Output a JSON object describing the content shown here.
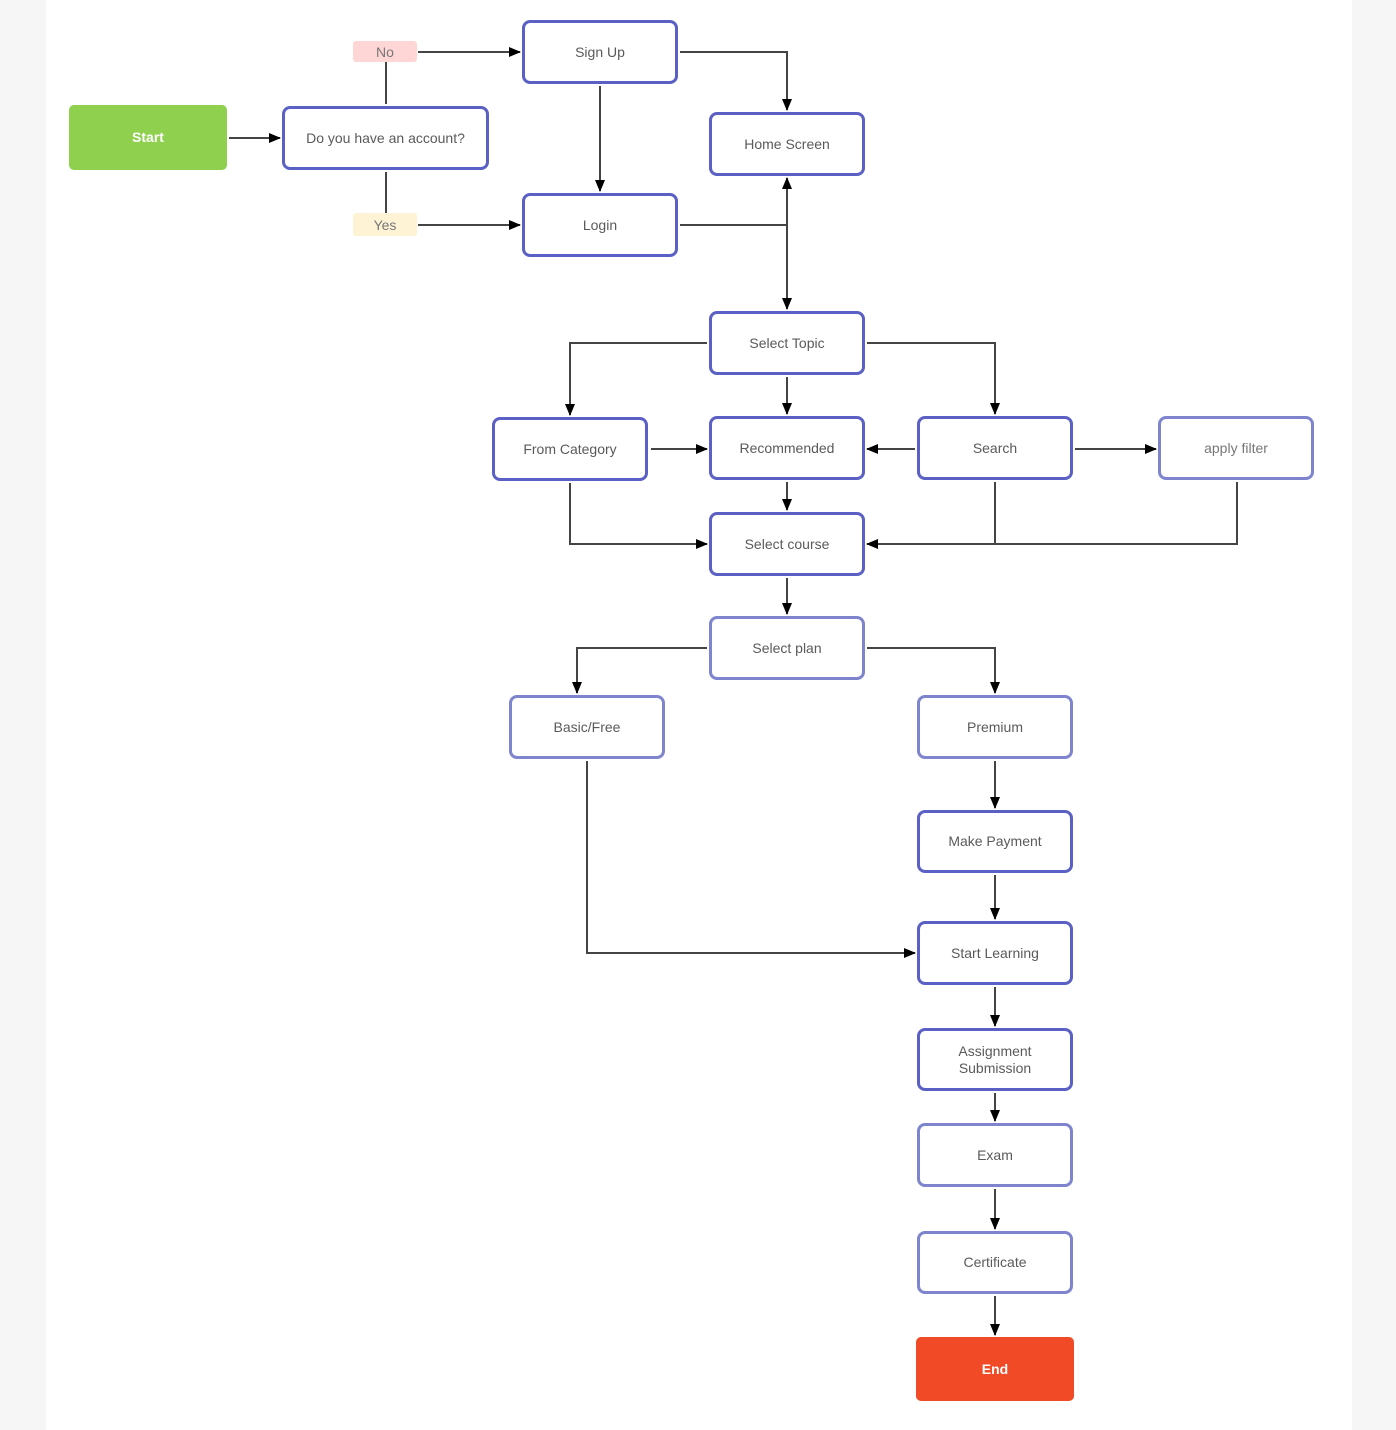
{
  "colors": {
    "node_border": "#5b60c4",
    "start": "#8fd14f",
    "end": "#f04a26",
    "no_tag": "#ffd6d6",
    "yes_tag": "#fff3d6",
    "connector": "#444444"
  },
  "nodes": {
    "start": "Start",
    "question": "Do you have an account?",
    "sign_up": "Sign Up",
    "login": "Login",
    "home": "Home Screen",
    "select_topic": "Select Topic",
    "from_category": "From Category",
    "recommended": "Recommended",
    "search": "Search",
    "apply_filter": "apply filter",
    "select_course": "Select course",
    "select_plan": "Select plan",
    "basic": "Basic/Free",
    "premium": "Premium",
    "payment": "Make Payment",
    "start_learning": "Start Learning",
    "assignment": "Assignment Submission",
    "exam": "Exam",
    "certificate": "Certificate",
    "end": "End"
  },
  "tags": {
    "no": "No",
    "yes": "Yes"
  }
}
